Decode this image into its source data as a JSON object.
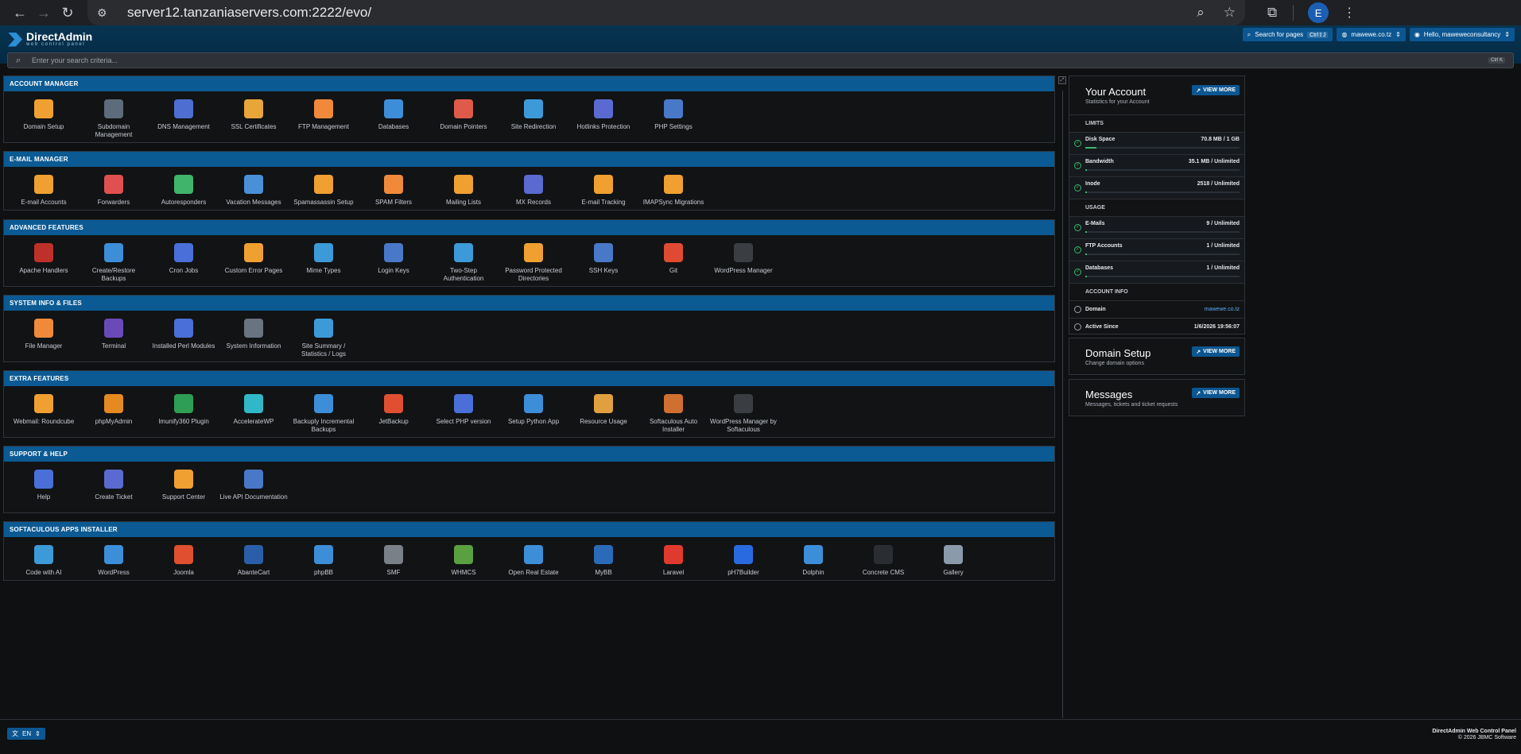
{
  "browser": {
    "url": "server12.tanzaniaservers.com:2222/evo/",
    "profile_initial": "E"
  },
  "header": {
    "logo_name": "DirectAdmin",
    "logo_sub": "web control panel",
    "search_pages_label": "Search for pages",
    "search_pages_shortcut": "Ctrl⇧J",
    "domain_select": "mawewe.co.tz",
    "user_greeting": "Hello, maweweconsultancy",
    "search_placeholder": "Enter your search criteria...",
    "search_shortcut": "Ctrl K"
  },
  "sections": [
    {
      "title": "ACCOUNT MANAGER",
      "items": [
        {
          "label": "Domain Setup",
          "icon": "globe-www-icon",
          "color": "#f0a030"
        },
        {
          "label": "Subdomain Management",
          "icon": "subdomain-icon",
          "color": "#5d6b7a"
        },
        {
          "label": "DNS Management",
          "icon": "dns-icon",
          "color": "#4e6fd1"
        },
        {
          "label": "SSL Certificates",
          "icon": "ssl-badge-icon",
          "color": "#e8a53a"
        },
        {
          "label": "FTP Management",
          "icon": "ftp-folder-icon",
          "color": "#f08a3a"
        },
        {
          "label": "Databases",
          "icon": "sql-database-icon",
          "color": "#3d8ed8"
        },
        {
          "label": "Domain Pointers",
          "icon": "domain-pointer-icon",
          "color": "#e05a4a"
        },
        {
          "label": "Site Redirection",
          "icon": "signpost-icon",
          "color": "#3d9ad8"
        },
        {
          "label": "Hotlinks Protection",
          "icon": "padlock-icon",
          "color": "#5a6ad0"
        },
        {
          "label": "PHP Settings",
          "icon": "php-icon",
          "color": "#4a78c8"
        }
      ]
    },
    {
      "title": "E-MAIL MANAGER",
      "items": [
        {
          "label": "E-mail Accounts",
          "icon": "email-account-icon",
          "color": "#f0a030"
        },
        {
          "label": "Forwarders",
          "icon": "forwarder-icon",
          "color": "#e05050"
        },
        {
          "label": "Autoresponders",
          "icon": "autoresponder-icon",
          "color": "#3fb46a"
        },
        {
          "label": "Vacation Messages",
          "icon": "vacation-icon",
          "color": "#4a90d8"
        },
        {
          "label": "Spamassassin Setup",
          "icon": "spamassassin-icon",
          "color": "#f0a030"
        },
        {
          "label": "SPAM Filters",
          "icon": "spam-filter-icon",
          "color": "#f08a3a"
        },
        {
          "label": "Mailing Lists",
          "icon": "mailing-list-icon",
          "color": "#f0a030"
        },
        {
          "label": "MX Records",
          "icon": "mx-records-icon",
          "color": "#5a6ad0"
        },
        {
          "label": "E-mail Tracking",
          "icon": "email-tracking-icon",
          "color": "#f0a030"
        },
        {
          "label": "IMAPSync Migrations",
          "icon": "imapsync-icon",
          "color": "#f0a030"
        }
      ]
    },
    {
      "title": "ADVANCED FEATURES",
      "items": [
        {
          "label": "Apache Handlers",
          "icon": "apache-feather-icon",
          "color": "#c0302a"
        },
        {
          "label": "Create/Restore Backups",
          "icon": "backup-icon",
          "color": "#3d8ed8"
        },
        {
          "label": "Cron Jobs",
          "icon": "cron-jobs-icon",
          "color": "#4a6fd8"
        },
        {
          "label": "Custom Error Pages",
          "icon": "error-page-icon",
          "color": "#f0a030"
        },
        {
          "label": "Mime Types",
          "icon": "mime-types-icon",
          "color": "#3d9ad8"
        },
        {
          "label": "Login Keys",
          "icon": "login-keys-icon",
          "color": "#4a78c8"
        },
        {
          "label": "Two-Step Authentication",
          "icon": "two-step-auth-icon",
          "color": "#3d9ad8"
        },
        {
          "label": "Password Protected Directories",
          "icon": "protected-folder-icon",
          "color": "#f0a030"
        },
        {
          "label": "SSH Keys",
          "icon": "ssh-keys-icon",
          "color": "#4a78c8"
        },
        {
          "label": "Git",
          "icon": "git-icon",
          "color": "#e04a32"
        },
        {
          "label": "WordPress Manager",
          "icon": "wordpress-icon",
          "color": "#3a3d42"
        }
      ]
    },
    {
      "title": "SYSTEM INFO & FILES",
      "items": [
        {
          "label": "File Manager",
          "icon": "file-manager-icon",
          "color": "#f08a3a"
        },
        {
          "label": "Terminal",
          "icon": "terminal-ssh-icon",
          "color": "#6a4ab8"
        },
        {
          "label": "Installed Perl Modules",
          "icon": "perl-onion-icon",
          "color": "#4a6fd8"
        },
        {
          "label": "System Information",
          "icon": "system-info-icon",
          "color": "#6a7380"
        },
        {
          "label": "Site Summary / Statistics / Logs",
          "icon": "statistics-icon",
          "color": "#3d9ad8"
        }
      ]
    },
    {
      "title": "EXTRA FEATURES",
      "items": [
        {
          "label": "Webmail: Roundcube",
          "icon": "roundcube-icon",
          "color": "#f0a030"
        },
        {
          "label": "phpMyAdmin",
          "icon": "phpmyadmin-icon",
          "color": "#e58a20"
        },
        {
          "label": "Imunify360 Plugin",
          "icon": "imunify-icon",
          "color": "#2e9e55"
        },
        {
          "label": "AccelerateWP",
          "icon": "acceleratewp-icon",
          "color": "#30b8c8"
        },
        {
          "label": "Backuply Incremental Backups",
          "icon": "cloud-upload-icon",
          "color": "#3d8ed8"
        },
        {
          "label": "JetBackup",
          "icon": "jetbackup-icon",
          "color": "#e05030"
        },
        {
          "label": "Select PHP version",
          "icon": "php-version-icon",
          "color": "#4a6fd8"
        },
        {
          "label": "Setup Python App",
          "icon": "python-icon",
          "color": "#3d8ed8"
        },
        {
          "label": "Resource Usage",
          "icon": "resource-gauge-icon",
          "color": "#e0a040"
        },
        {
          "label": "Softaculous Auto Installer",
          "icon": "softaculous-icon",
          "color": "#d07030"
        },
        {
          "label": "WordPress Manager by Softaculous",
          "icon": "wordpress-icon",
          "color": "#3a3d42"
        }
      ]
    },
    {
      "title": "SUPPORT & HELP",
      "items": [
        {
          "label": "Help",
          "icon": "help-agent-icon",
          "color": "#4a6fd8"
        },
        {
          "label": "Create Ticket",
          "icon": "ticket-icon",
          "color": "#5a6ad0"
        },
        {
          "label": "Support Center",
          "icon": "support-center-icon",
          "color": "#f0a030"
        },
        {
          "label": "Live API Documentation",
          "icon": "api-icon",
          "color": "#4a78c8"
        }
      ]
    },
    {
      "title": "SOFTACULOUS APPS INSTALLER",
      "items": [
        {
          "label": "Code with AI",
          "icon": "ai-robot-icon",
          "color": "#3d9ad8"
        },
        {
          "label": "WordPress",
          "icon": "wordpress-icon",
          "color": "#3d8ed8"
        },
        {
          "label": "Joomla",
          "icon": "joomla-icon",
          "color": "#e05030"
        },
        {
          "label": "AbanteCart",
          "icon": "abantecart-icon",
          "color": "#2a5ea8"
        },
        {
          "label": "phpBB",
          "icon": "phpbb-icon",
          "color": "#3d8ed8"
        },
        {
          "label": "SMF",
          "icon": "smf-icon",
          "color": "#7a8088"
        },
        {
          "label": "WHMCS",
          "icon": "whmcs-icon",
          "color": "#5aa040"
        },
        {
          "label": "Open Real Estate",
          "icon": "real-estate-icon",
          "color": "#3d8ed8"
        },
        {
          "label": "MyBB",
          "icon": "mybb-icon",
          "color": "#2a6ab8"
        },
        {
          "label": "Laravel",
          "icon": "laravel-icon",
          "color": "#e03a2e"
        },
        {
          "label": "pH7Builder",
          "icon": "ph7builder-icon",
          "color": "#2a6ae0"
        },
        {
          "label": "Dolphin",
          "icon": "dolphin-icon",
          "color": "#3d8ed8"
        },
        {
          "label": "Concrete CMS",
          "icon": "concrete-hand-icon",
          "color": "#2a2d32"
        },
        {
          "label": "Gallery",
          "icon": "gallery-icon",
          "color": "#8a9aaa"
        }
      ]
    }
  ],
  "sidebar": {
    "account": {
      "title": "Your Account",
      "subtitle": "Statistics for your Account",
      "view_more": "VIEW MORE",
      "limits_heading": "LIMITS",
      "limits": [
        {
          "label": "Disk Space",
          "value": "70.8 MB / 1 GB",
          "fill": 0.07
        },
        {
          "label": "Bandwidth",
          "value": "35.1 MB / Unlimited",
          "fill": 0.0
        },
        {
          "label": "Inode",
          "value": "2518 / Unlimited",
          "fill": 0.01
        }
      ],
      "usage_heading": "USAGE",
      "usage": [
        {
          "label": "E-Mails",
          "value": "9 / Unlimited",
          "fill": 0.01
        },
        {
          "label": "FTP Accounts",
          "value": "1 / Unlimited",
          "fill": 0.01
        },
        {
          "label": "Databases",
          "value": "1 / Unlimited",
          "fill": 0.01
        }
      ],
      "info_heading": "ACCOUNT INFO",
      "domain_label": "Domain",
      "domain_value": "mawewe.co.tz",
      "since_label": "Active Since",
      "since_value": "1/6/2026 19:56:07"
    },
    "domain_setup": {
      "title": "Domain Setup",
      "subtitle": "Change domain options",
      "view_more": "VIEW MORE"
    },
    "messages": {
      "title": "Messages",
      "subtitle": "Messages, tickets and ticket requests",
      "view_more": "VIEW MORE"
    }
  },
  "footer": {
    "language": "EN",
    "line1": "DirectAdmin Web Control Panel",
    "line2": "© 2026 JBMC Software"
  }
}
